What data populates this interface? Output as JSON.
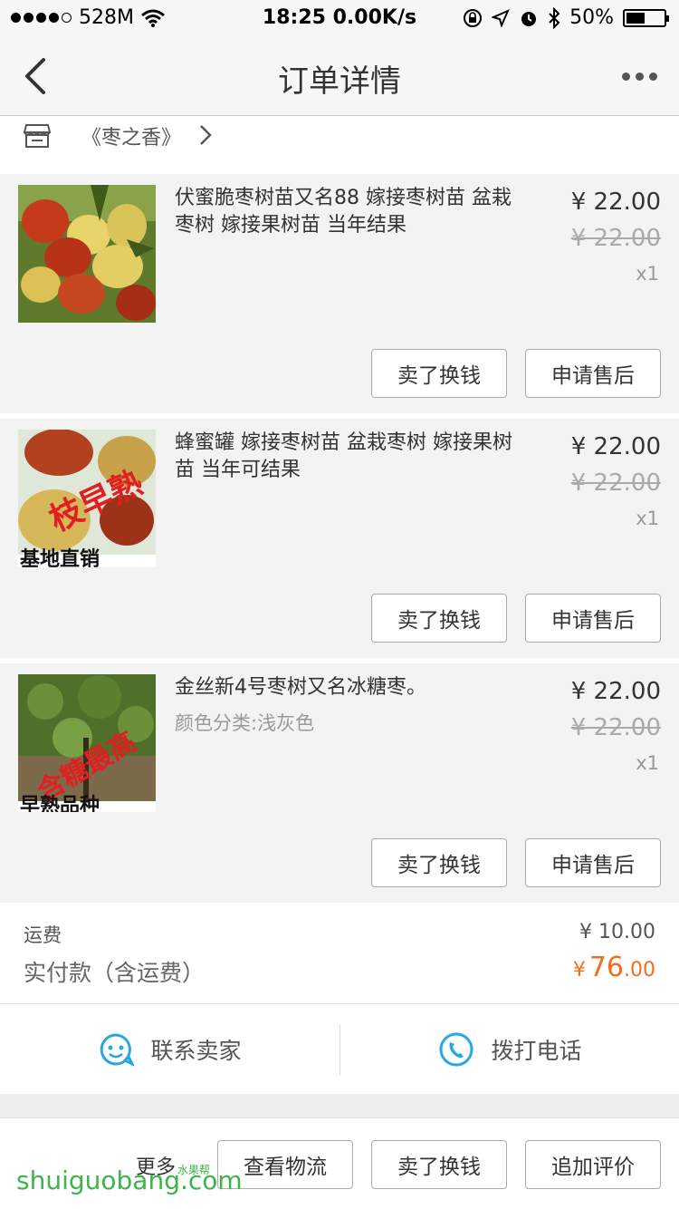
{
  "status_bar": {
    "carrier": "528M",
    "time_speed": "18:25 0.00K/s",
    "battery": "50%",
    "battery_level": 0.5
  },
  "nav": {
    "title": "订单详情"
  },
  "shop": {
    "name": "《枣之香》"
  },
  "items": [
    {
      "title": "伏蜜脆枣树苗又名88 嫁接枣树苗 盆栽枣树 嫁接果树苗 当年结果",
      "sku": "",
      "price": "¥ 22.00",
      "original_price": "¥ 22.00",
      "qty": "x1",
      "sell_label": "卖了换钱",
      "after_sale_label": "申请售后"
    },
    {
      "title": "蜂蜜罐  嫁接枣树苗 盆栽枣树  嫁接果树苗 当年可结果",
      "sku": "",
      "price": "¥ 22.00",
      "original_price": "¥ 22.00",
      "qty": "x1",
      "image_text": "枝早熟",
      "image_caption": "基地直销",
      "sell_label": "卖了换钱",
      "after_sale_label": "申请售后"
    },
    {
      "title": "金丝新4号枣树又名冰糖枣。",
      "sku": "颜色分类:浅灰色",
      "price": "¥ 22.00",
      "original_price": "¥ 22.00",
      "qty": "x1",
      "image_text": "含糖最高",
      "image_caption": "早熟品种",
      "sell_label": "卖了换钱",
      "after_sale_label": "申请售后"
    }
  ],
  "totals": {
    "shipping_label": "运费",
    "shipping_value": "¥ 10.00",
    "paid_label": "实付款（含运费）",
    "paid_symbol": "¥",
    "paid_int": "76",
    "paid_dec": ".00"
  },
  "contact": {
    "seller_label": "联系卖家",
    "call_label": "拨打电话"
  },
  "bottom": {
    "more_label": "更多",
    "logistics_label": "查看物流",
    "sell_label": "卖了换钱",
    "review_label": "追加评价",
    "watermark": "shuiguobang.com",
    "watermark_small": "水果帮"
  },
  "colors": {
    "accent_orange": "#f26e1f",
    "icon_blue": "#2aa7e0"
  }
}
